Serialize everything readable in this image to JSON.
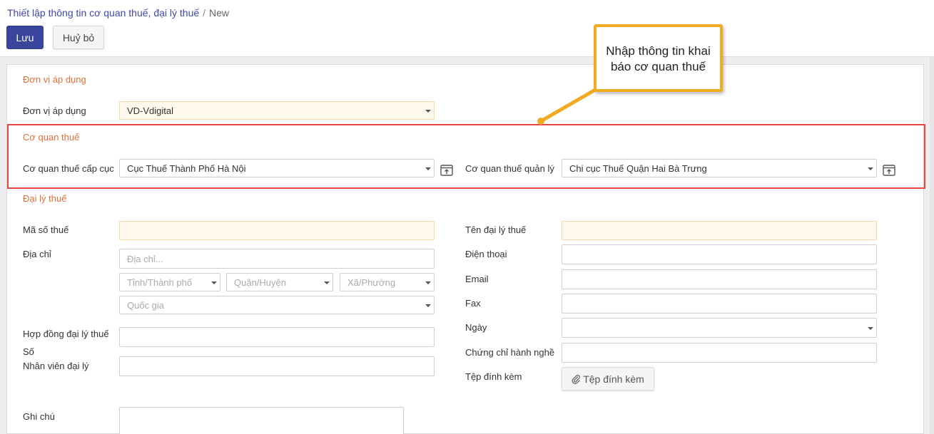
{
  "header": {
    "breadcrumb_parent": "Thiết lập thông tin cơ quan thuế, đại lý thuế",
    "breadcrumb_sep": "/",
    "breadcrumb_current": "New",
    "save_label": "Lưu",
    "cancel_label": "Huỷ bỏ"
  },
  "callout": {
    "line1": "Nhập thông tin khai",
    "line2": "báo cơ quan thuế"
  },
  "section_unit": {
    "title": "Đơn vị áp dụng",
    "label": "Đơn vị áp dụng",
    "value": "VD-Vdigital"
  },
  "section_tax_office": {
    "title": "Cơ quan thuế",
    "dept_label": "Cơ quan thuế cấp cục",
    "dept_value": "Cục Thuế Thành Phố Hà Nội",
    "manage_label": "Cơ quan thuế quản lý",
    "manage_value": "Chi cục Thuế Quận Hai Bà Trưng"
  },
  "section_agent": {
    "title": "Đại lý thuế",
    "tax_code_label": "Mã số thuế",
    "address_label": "Địa chỉ",
    "address_placeholder": "Địa chỉ...",
    "province_placeholder": "Tỉnh/Thành phố",
    "district_placeholder": "Quận/Huyện",
    "ward_placeholder": "Xã/Phường",
    "country_placeholder": "Quốc gia",
    "contract_label_line1": "Hợp đồng đại lý thuế",
    "contract_label_line2": "Số",
    "staff_label": "Nhân viên đại lý",
    "note_label": "Ghi chú",
    "agent_name_label": "Tên đại lý thuế",
    "phone_label": "Điện thoại",
    "email_label": "Email",
    "fax_label": "Fax",
    "date_label": "Ngày",
    "certificate_label": "Chứng chỉ hành nghề",
    "attachment_label": "Tệp đính kèm",
    "attachment_button": "Tệp đính kèm"
  },
  "colors": {
    "primary": "#3a469e",
    "section_title": "#e0703a",
    "highlight": "#e84545",
    "callout_border": "#f1ab22",
    "required_bg": "#fff8ec"
  },
  "icons": {
    "external_link": "external-link-icon",
    "paperclip": "paperclip-icon",
    "dropdown": "chevron-down-icon"
  }
}
